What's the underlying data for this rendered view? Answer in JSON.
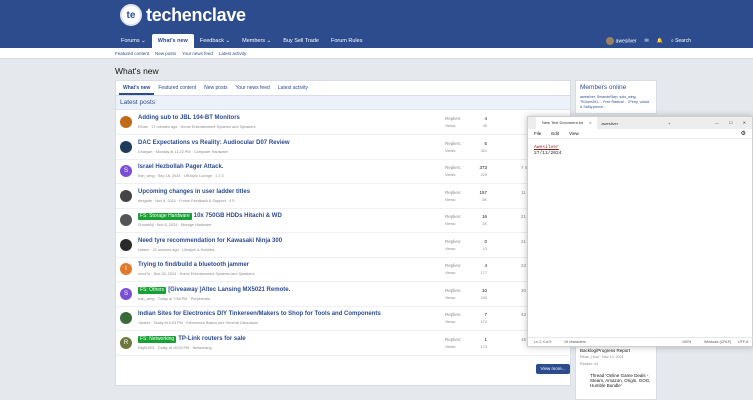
{
  "brand": {
    "badge": "te",
    "name": "techenclave"
  },
  "nav": {
    "tabs": [
      "Forums ⌄",
      "What's new",
      "Feedback ⌄",
      "Members ⌄",
      "Buy Sell Trade",
      "Forum Rules"
    ],
    "user": "awesilver",
    "search": "Search"
  },
  "subnav": [
    "Featured content",
    "New posts",
    "Your news feed",
    "Latest activity"
  ],
  "page_title": "What's new",
  "tabs": [
    "What's new",
    "Featured content",
    "New posts",
    "Your news feed",
    "Latest activity"
  ],
  "section": "Latest posts",
  "labels": {
    "replies": "Replies:",
    "views": "Views:"
  },
  "threads": [
    {
      "title": "Adding sub to JBL 104-BT Monitors",
      "prefix": "",
      "meta": "Ethan · 17 minutes ago · Home Entertainment Systems and Speakers",
      "replies": "4",
      "views": "45",
      "last": "",
      "av": "#c06a1a",
      "ch": ""
    },
    {
      "title": "DAC Expectations vs Reality: Audiocular D07 Review",
      "prefix": "",
      "meta": "Dharyah · Monday at 11:22 PM · Computer Hardware",
      "replies": "5",
      "views": "321",
      "last": "",
      "av": "#1f3a5a",
      "ch": ""
    },
    {
      "title": "Israel Hezbollah Pager Attack.",
      "prefix": "",
      "meta": "tran_wing · Sep 18, 2024 · Off-topic Lounge · 1 2 3",
      "replies": "373",
      "views": "229",
      "last": "7 m",
      "av": "#7a4fd6",
      "ch": "S"
    },
    {
      "title": "Upcoming changes in user ladder titles",
      "prefix": "",
      "meta": "rbrigade · Nov 6, 2024 · Forum Feedback & Support · 4 5",
      "replies": "157",
      "views": "5K",
      "last": "11 m",
      "av": "#444",
      "ch": ""
    },
    {
      "title": "10x 750GB HDDs Hitachi & WD",
      "prefix": "FS: Storage Hardware",
      "meta": "ShoaibNj · Nov 6, 2024 · Storage Hardware",
      "replies": "16",
      "views": "1K",
      "last": "21 m",
      "av": "#555",
      "ch": ""
    },
    {
      "title": "Need tyre recommendation for Kawasaki Ninja 300",
      "prefix": "",
      "meta": "kirfane · 21 minutes ago · Lifestyle & Hobbies",
      "replies": "0",
      "views": "13",
      "last": "21 m",
      "av": "#2a2a2a",
      "ch": ""
    },
    {
      "title": "Trying to find/build a bluetooth jammer",
      "prefix": "",
      "meta": "mxxt7n · Nov 28, 2024 · Home Entertainment Systems and Speakers",
      "replies": "4",
      "views": "177",
      "last": "23 m",
      "av": "#e07a2a",
      "ch": "I"
    },
    {
      "title": "[Giveaway ]Altec Lansing MX5021 Remote.",
      "prefix": "FS: Others",
      "meta": "tran_wing · Today at 7:58 PM · Peripherals",
      "replies": "10",
      "views": "240",
      "last": "30 m",
      "av": "#7a4fd6",
      "ch": "S"
    },
    {
      "title": "Indian Sites for Electronics DIY Tinkereen/Makers to Shop for Tools and Components",
      "prefix": "",
      "meta": "Yadeer · Today at 6:03 PM · Electronics Basics and General Discussion",
      "replies": "7",
      "views": "174",
      "last": "43 m",
      "av": "#3a6a3a",
      "ch": ""
    },
    {
      "title": "TP-Link routers for sale",
      "prefix": "FS: Networking",
      "meta": "Raj91903 · Today at 10:09 PM · Networking",
      "replies": "1",
      "views": "173",
      "last": "45 m",
      "av": "#6b7a3a",
      "ch": "R"
    }
  ],
  "view_more": "View more...",
  "sidebar": {
    "title": "Members online",
    "text": "awesilver, SmandeStep, solo_wing, TEUser261..., Free Radical ... iPerry, voloid & Sahly.prince...",
    "bottom_text": "Backlog/Progress Report",
    "bottom_meta": "Ethan_Hunt · Nov 10, 2024",
    "bottom_meta2": "Replies: 44",
    "bottom_title": "Thread 'Online Game Deals - Steam, Amazon, Origin, GOG, Humble Bundle'"
  },
  "notepad": {
    "tab": "New Text Document.txt",
    "tab2": "awesilver",
    "menu": [
      "File",
      "Edit",
      "View"
    ],
    "line1": "Awesilver",
    "line2": "27/11/2024",
    "status": [
      "Ln 1, Col 9",
      "19 characters",
      "100%",
      "Windows (CRLF)",
      "UTF-8"
    ]
  }
}
